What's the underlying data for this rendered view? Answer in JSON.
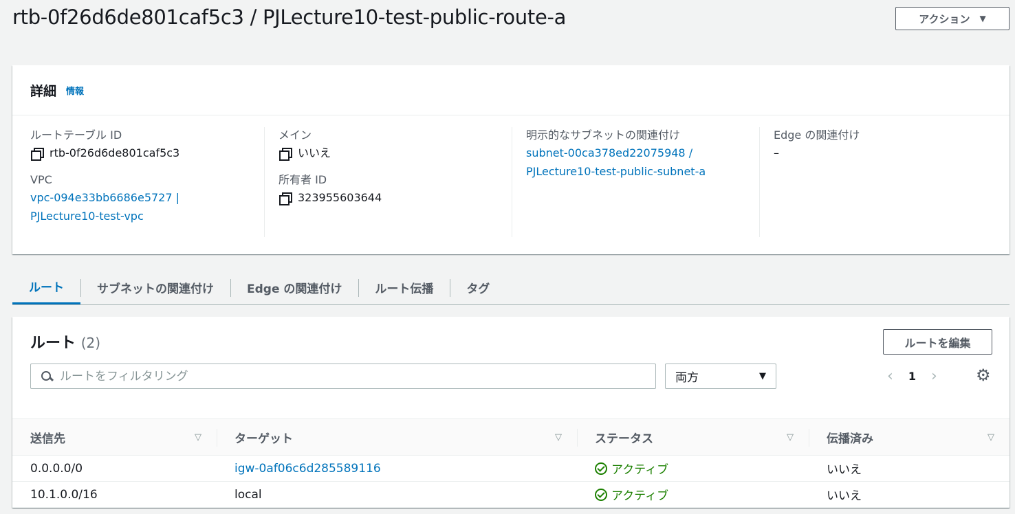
{
  "header": {
    "title": "rtb-0f26d6de801caf5c3 / PJLecture10-test-public-route-a",
    "actions_label": "アクション"
  },
  "details": {
    "title": "詳細",
    "info_label": "情報",
    "route_table_id_label": "ルートテーブル ID",
    "route_table_id": "rtb-0f26d6de801caf5c3",
    "vpc_label": "VPC",
    "vpc_line1": "vpc-094e33bb6686e5727 |",
    "vpc_line2": "PJLecture10-test-vpc",
    "main_label": "メイン",
    "main_value": "いいえ",
    "owner_label": "所有者 ID",
    "owner_value": "323955603644",
    "subnet_assoc_label": "明示的なサブネットの関連付け",
    "subnet_line1": "subnet-00ca378ed22075948 /",
    "subnet_line2": "PJLecture10-test-public-subnet-a",
    "edge_assoc_label": "Edge の関連付け",
    "edge_assoc_value": "–"
  },
  "tabs": [
    {
      "label": "ルート",
      "active": true
    },
    {
      "label": "サブネットの関連付け",
      "active": false
    },
    {
      "label": "Edge の関連付け",
      "active": false
    },
    {
      "label": "ルート伝播",
      "active": false
    },
    {
      "label": "タグ",
      "active": false
    }
  ],
  "routes": {
    "title": "ルート",
    "count": "(2)",
    "edit_label": "ルートを編集",
    "filter_placeholder": "ルートをフィルタリング",
    "select_value": "両方",
    "page": "1",
    "columns": [
      "送信先",
      "ターゲット",
      "ステータス",
      "伝播済み"
    ],
    "rows": [
      {
        "destination": "0.0.0.0/0",
        "target": "igw-0af06c6d285589116",
        "status": "アクティブ",
        "propagated": "いいえ"
      },
      {
        "destination": "10.1.0.0/16",
        "target": "local",
        "status": "アクティブ",
        "propagated": "いいえ"
      }
    ]
  },
  "colors": {
    "link": "#0073bb",
    "status_ok": "#1d8102",
    "background": "#f2f3f3"
  }
}
